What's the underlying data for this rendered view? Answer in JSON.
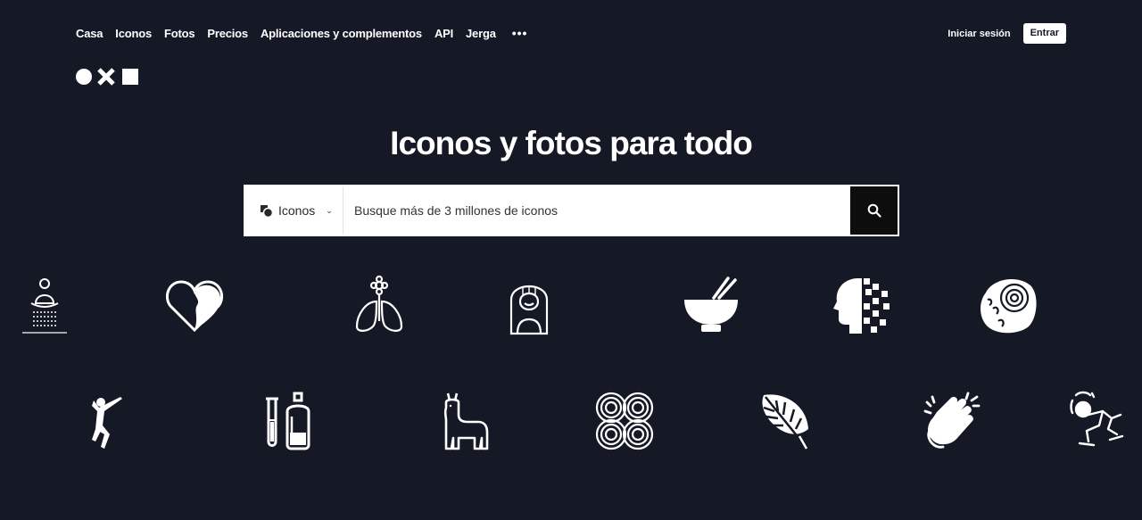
{
  "nav": {
    "items": [
      "Casa",
      "Iconos",
      "Fotos",
      "Precios",
      "Aplicaciones y complementos",
      "API",
      "Jerga"
    ],
    "more_label": "•••"
  },
  "auth": {
    "login_label": "Iniciar sesión",
    "join_label": "Entrar"
  },
  "hero": {
    "title": "Iconos y fotos para todo"
  },
  "search": {
    "type_label": "Iconos",
    "placeholder": "Busque más de 3 millones de iconos"
  },
  "colors": {
    "background": "#151825",
    "button": "#0d0d0d",
    "foreground": "#ffffff"
  },
  "gallery": {
    "row1": [
      "meditation-icon",
      "heart-face-icon",
      "lungs-flower-icon",
      "woman-portrait-icon",
      "bowl-chopsticks-icon",
      "pixel-head-icon",
      "ammonite-fossil-icon"
    ],
    "row2": [
      "dancer-icon",
      "test-tubes-icon",
      "llama-icon",
      "knot-pattern-icon",
      "monstera-leaf-icon",
      "clapping-hands-icon",
      "skateboarder-icon"
    ]
  }
}
